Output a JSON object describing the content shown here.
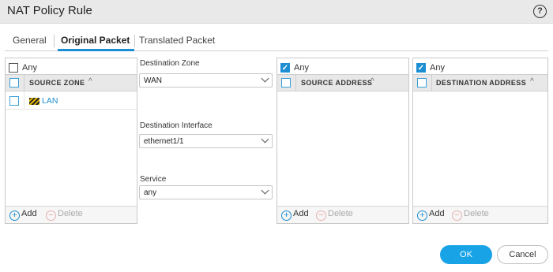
{
  "dialog": {
    "title": "NAT Policy Rule",
    "help_icon": "question-circle-icon",
    "help_glyph": "?"
  },
  "tabs": [
    {
      "label": "General",
      "active": false
    },
    {
      "label": "Original Packet",
      "active": true
    },
    {
      "label": "Translated Packet",
      "active": false
    }
  ],
  "source_zone": {
    "any_label": "Any",
    "any_checked": false,
    "column_header": "SOURCE ZONE",
    "sort_glyph": "^",
    "rows": [
      {
        "label": "LAN",
        "icon": "zone-icon"
      }
    ],
    "add_label": "Add",
    "delete_label": "Delete"
  },
  "destination": {
    "zone_label": "Destination Zone",
    "zone_value": "WAN",
    "interface_label": "Destination Interface",
    "interface_value": "ethernet1/1",
    "service_label": "Service",
    "service_value": "any"
  },
  "source_address": {
    "any_label": "Any",
    "any_checked": true,
    "column_header": "SOURCE ADDRESS",
    "sort_glyph": "^",
    "add_label": "Add",
    "delete_label": "Delete"
  },
  "destination_address": {
    "any_label": "Any",
    "any_checked": true,
    "column_header": "DESTINATION ADDRESS",
    "sort_glyph": "^",
    "add_label": "Add",
    "delete_label": "Delete"
  },
  "footer": {
    "ok_label": "OK",
    "cancel_label": "Cancel"
  },
  "glyphs": {
    "check": "✓",
    "plus": "+",
    "minus": "−"
  },
  "colors": {
    "accent": "#17a3e6",
    "link": "#1b8ed1"
  }
}
